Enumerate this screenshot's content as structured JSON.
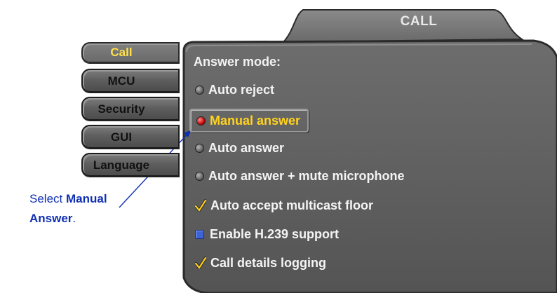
{
  "title": "CALL",
  "sidebar": {
    "items": [
      {
        "label": "Call",
        "active": true
      },
      {
        "label": "MCU",
        "active": false
      },
      {
        "label": "Security",
        "active": false
      },
      {
        "label": "GUI",
        "active": false
      },
      {
        "label": "Language",
        "active": false
      }
    ]
  },
  "main": {
    "heading": "Answer mode:",
    "options": [
      {
        "label": "Auto reject",
        "control": "radio",
        "selected": false
      },
      {
        "label": "Manual answer",
        "control": "radio",
        "selected": true
      },
      {
        "label": "Auto answer",
        "control": "radio",
        "selected": false
      },
      {
        "label": "Auto answer + mute microphone",
        "control": "radio",
        "selected": false
      },
      {
        "label": "Auto accept multicast floor",
        "control": "checkbox",
        "checked": true
      },
      {
        "label": "Enable H.239 support",
        "control": "checkbox",
        "checked": false
      },
      {
        "label": "Call details logging",
        "control": "checkbox",
        "checked": true
      }
    ]
  },
  "callout": {
    "prefix": "Select ",
    "bold1": "Manual",
    "bold2": "Answer",
    "suffix": "."
  },
  "colors": {
    "panel": "#5e5e5e",
    "active_tab_text": "#ffe14a",
    "selected_option_text": "#ffd21f",
    "callout_text": "#0f2fb3",
    "selected_radio": "#c00000"
  }
}
